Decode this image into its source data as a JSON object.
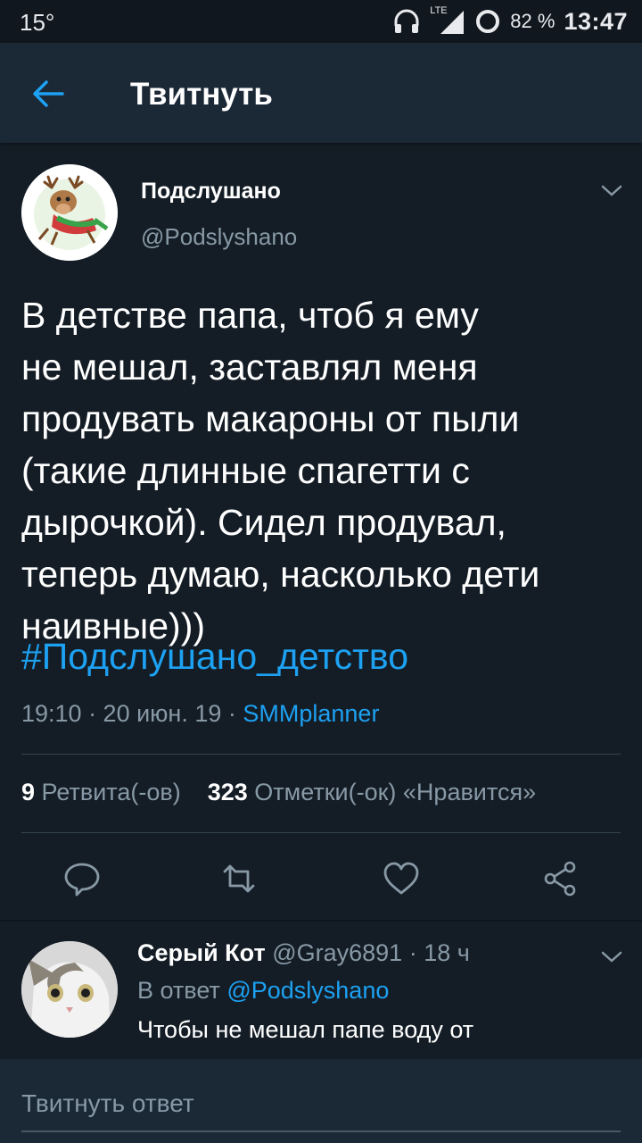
{
  "status_bar": {
    "temperature": "15°",
    "network": "LTE",
    "battery": "82 %",
    "time": "13:47"
  },
  "header": {
    "title": "Твитнуть"
  },
  "tweet": {
    "author_name": "Подслушано",
    "author_handle": "@Podslyshano",
    "text_lines": [
      "В детстве папа, чтоб я ему",
      "не мешал, заставлял меня",
      "продувать макароны от пыли",
      "(такие длинные спагетти с",
      "дырочкой). Сидел продувал,",
      "теперь думаю, насколько дети",
      "наивные)))"
    ],
    "hashtag": "#Подслушано_детство",
    "timestamp": "19:10 · 20 июн. 19 · ",
    "source": "SMMplanner",
    "retweet_count": "9",
    "retweet_label": "Ретвита(-ов)",
    "like_count": "323",
    "like_label": "Отметки(-ок) «Нравится»"
  },
  "reply": {
    "author_name": "Серый Кот",
    "meta": "@Gray6891 · 18 ч",
    "reply_to_label": "В ответ",
    "reply_to_handle": "@Podslyshano",
    "text": "Чтобы не мешал папе воду от"
  },
  "compose": {
    "placeholder": "Твитнуть ответ"
  },
  "colors": {
    "background": "#141d26",
    "header": "#1b2836",
    "accent": "#1da1f2",
    "secondary_text": "#8899a6"
  },
  "icons": [
    "back-arrow-icon",
    "headphones-icon",
    "signal-icon",
    "battery-icon",
    "chevron-down-icon",
    "reply-icon",
    "retweet-icon",
    "like-icon",
    "share-icon"
  ]
}
